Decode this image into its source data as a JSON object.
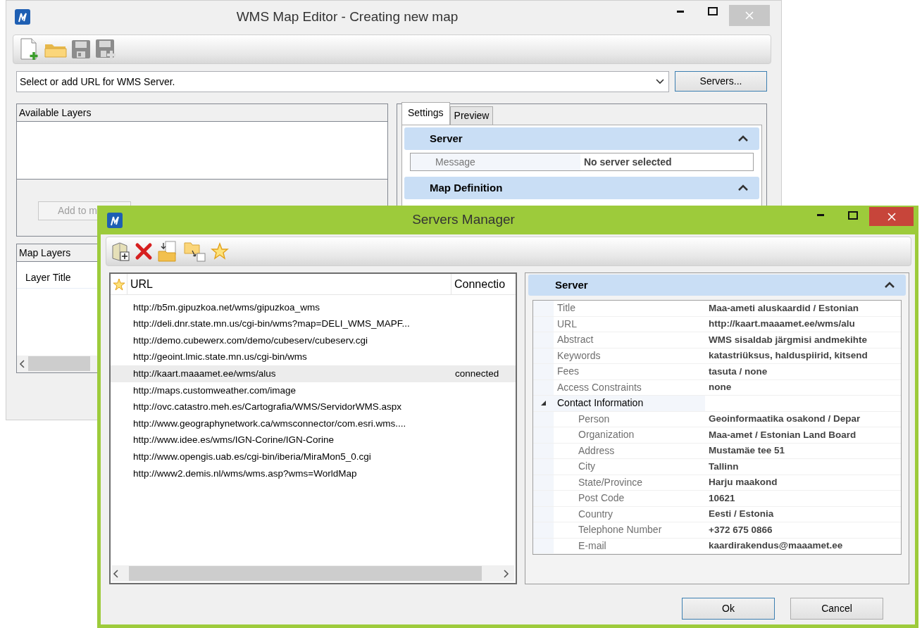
{
  "main_window": {
    "title": "WMS Map Editor - Creating new map",
    "url_combo": {
      "value": "Select or add URL for WMS Server."
    },
    "servers_button": "Servers...",
    "available_layers": {
      "header": "Available Layers",
      "add_button": "Add to m"
    },
    "map_layers": {
      "header": "Map Layers",
      "column": "Layer Title"
    },
    "tabs": [
      {
        "label": "Settings",
        "selected": true
      },
      {
        "label": "Preview",
        "selected": false
      }
    ],
    "sections": [
      {
        "title": "Server",
        "expanded": true,
        "rows": [
          {
            "label": "Message",
            "value": "No server selected"
          }
        ]
      },
      {
        "title": "Map Definition",
        "expanded": true
      }
    ]
  },
  "servers_manager": {
    "title": "Servers Manager",
    "columns": [
      "URL",
      "Connectio"
    ],
    "servers": [
      {
        "url": "http://b5m.gipuzkoa.net/wms/gipuzkoa_wms",
        "selected": false
      },
      {
        "url": "http://deli.dnr.state.mn.us/cgi-bin/wms?map=DELI_WMS_MAPF...",
        "selected": false
      },
      {
        "url": "http://demo.cubewerx.com/demo/cubeserv/cubeserv.cgi",
        "selected": false
      },
      {
        "url": "http://geoint.lmic.state.mn.us/cgi-bin/wms",
        "selected": false
      },
      {
        "url": "http://kaart.maaamet.ee/wms/alus",
        "connection": "connected",
        "selected": true
      },
      {
        "url": "http://maps.customweather.com/image",
        "selected": false
      },
      {
        "url": "http://ovc.catastro.meh.es/Cartografia/WMS/ServidorWMS.aspx",
        "selected": false
      },
      {
        "url": "http://www.geographynetwork.ca/wmsconnector/com.esri.wms....",
        "selected": false
      },
      {
        "url": "http://www.idee.es/wms/IGN-Corine/IGN-Corine",
        "selected": false
      },
      {
        "url": "http://www.opengis.uab.es/cgi-bin/iberia/MiraMon5_0.cgi",
        "selected": false
      },
      {
        "url": "http://www2.demis.nl/wms/wms.asp?wms=WorldMap",
        "selected": false
      }
    ],
    "properties": {
      "title": "Server",
      "expanded": true,
      "rows": [
        {
          "label": "Title",
          "value": "Maa-ameti aluskaardid / Estonian"
        },
        {
          "label": "URL",
          "value": "http://kaart.maaamet.ee/wms/alu"
        },
        {
          "label": "Abstract",
          "value": "WMS sisaldab järgmisi andmekihte"
        },
        {
          "label": "Keywords",
          "value": "katastriüksus, halduspiirid, kitsend"
        },
        {
          "label": "Fees",
          "value": "tasuta / none"
        },
        {
          "label": "Access Constraints",
          "value": "none"
        },
        {
          "label": "Contact Information",
          "expanded": true,
          "children": [
            {
              "label": "Person",
              "value": "Geoinformaatika osakond / Depar"
            },
            {
              "label": "Organization",
              "value": "Maa-amet / Estonian Land Board"
            },
            {
              "label": "Address",
              "value": "Mustamäe tee 51"
            },
            {
              "label": "City",
              "value": "Tallinn"
            },
            {
              "label": "State/Province",
              "value": "Harju maakond"
            },
            {
              "label": "Post Code",
              "value": "10621"
            },
            {
              "label": "Country",
              "value": "Eesti / Estonia"
            },
            {
              "label": "Telephone Number",
              "value": "+372 675 0866"
            },
            {
              "label": "E-mail",
              "value": "kaardirakendus@maaamet.ee"
            }
          ]
        }
      ]
    },
    "buttons": [
      "Ok",
      "Cancel"
    ]
  }
}
